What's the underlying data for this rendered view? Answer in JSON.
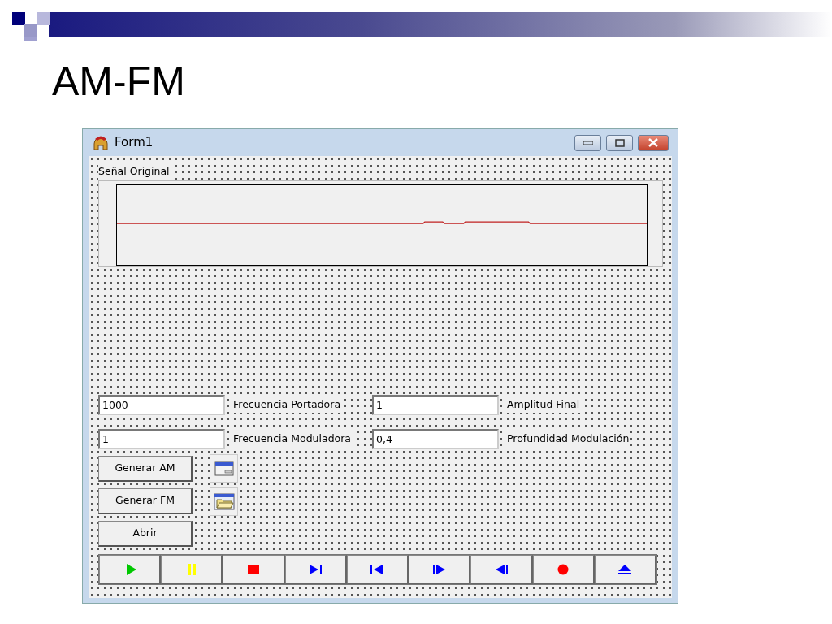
{
  "slide": {
    "title": "AM-FM"
  },
  "window": {
    "title": "Form1"
  },
  "signal_panel": {
    "label": "Señal Original"
  },
  "form_rows": [
    [
      {
        "kind": "input",
        "text": "1000"
      },
      {
        "kind": "caption",
        "text": "Frecuencia Portadora"
      },
      {
        "kind": "input",
        "text": "1"
      },
      {
        "kind": "caption",
        "text": "Amplitud Final"
      }
    ],
    [
      {
        "kind": "input",
        "text": "1"
      },
      {
        "kind": "caption",
        "text": "Frecuencia Moduladora"
      },
      {
        "kind": "input",
        "text": "0,4"
      },
      {
        "kind": "caption",
        "text": "Profundidad Modulación"
      }
    ]
  ],
  "buttons": [
    {
      "label": "Generar AM"
    },
    {
      "label": "Generar FM"
    },
    {
      "label": "Abrir"
    }
  ],
  "icon_buttons": [
    {
      "kind": "window"
    },
    {
      "kind": "folder"
    }
  ],
  "media_buttons": [
    {
      "kind": "play",
      "color": "#00c800"
    },
    {
      "kind": "pause",
      "color": "#ffff00"
    },
    {
      "kind": "stop",
      "color": "#ff0000"
    },
    {
      "kind": "next",
      "color": "#0000ff"
    },
    {
      "kind": "prev",
      "color": "#0000ff"
    },
    {
      "kind": "step",
      "color": "#0000ff"
    },
    {
      "kind": "back",
      "color": "#0000ff"
    },
    {
      "kind": "record",
      "color": "#ff0000"
    },
    {
      "kind": "eject",
      "color": "#0000ff"
    }
  ]
}
